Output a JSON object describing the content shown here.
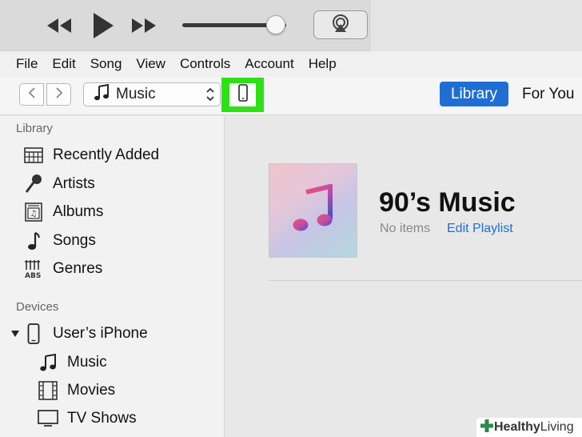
{
  "menu": [
    "File",
    "Edit",
    "Song",
    "View",
    "Controls",
    "Account",
    "Help"
  ],
  "player": {
    "icons": [
      "rewind-icon",
      "play-icon",
      "fast-forward-icon",
      "airplay-icon"
    ],
    "volume_level": 0.9
  },
  "toolbar": {
    "media_kind": "Music",
    "tab_library": "Library",
    "tab_for_you": "For You"
  },
  "sidebar": {
    "library_heading": "Library",
    "library_items": [
      {
        "label": "Recently Added",
        "icon": "grid-icon"
      },
      {
        "label": "Artists",
        "icon": "microphone-icon"
      },
      {
        "label": "Albums",
        "icon": "album-icon"
      },
      {
        "label": "Songs",
        "icon": "music-note-icon"
      },
      {
        "label": "Genres",
        "icon": "genres-icon"
      }
    ],
    "devices_heading": "Devices",
    "device_name": "User’s iPhone",
    "device_items": [
      {
        "label": "Music",
        "icon": "music-note-icon"
      },
      {
        "label": "Movies",
        "icon": "film-icon"
      },
      {
        "label": "TV Shows",
        "icon": "tv-icon"
      }
    ]
  },
  "playlist": {
    "title": "90’s Music",
    "count": "No items",
    "edit": "Edit Playlist"
  },
  "watermark": {
    "bold": "Healthy",
    "light": "Living"
  },
  "colors": {
    "accent": "#1f6ed4",
    "highlight": "#2ee016"
  }
}
